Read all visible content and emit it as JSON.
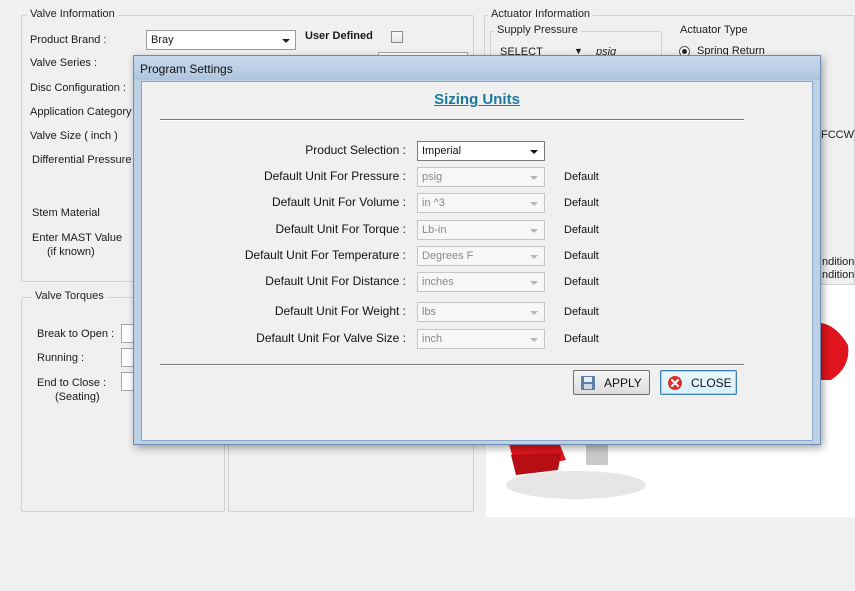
{
  "valve_info": {
    "legend": "Valve Information",
    "product_brand_label": "Product Brand :",
    "product_brand_value": "Bray",
    "user_defined_label": "User Defined",
    "valve_series_label": "Valve Series  :",
    "disc_config_label": "Disc Configuration :",
    "application_category_label": "Application Category",
    "valve_size_label": "Valve Size ( inch )",
    "differential_pressure_label": "Differential Pressure",
    "stem_material_label": "Stem Material",
    "enter_mast_label": "Enter MAST Value",
    "if_known_label": "(if known)"
  },
  "valve_torques": {
    "legend": "Valve Torques",
    "break_to_open_label": "Break to Open :",
    "running_label": "Running :",
    "end_to_close_label": "End to Close :",
    "seating_label": "(Seating)"
  },
  "actuator_info": {
    "legend": "Actuator Information",
    "supply_pressure_label": "Supply Pressure",
    "supply_pressure_value": "SELECT",
    "supply_pressure_unit": "psig",
    "actuator_type_label": "Actuator Type",
    "spring_return_label": "Spring Return",
    "fccw_fragment": "FCCW)",
    "condition_fragment_1": "ndition",
    "condition_fragment_2": "ndition"
  },
  "dialog": {
    "title": "Program Settings",
    "heading": "Sizing Units",
    "rows": [
      {
        "label": "Product Selection :",
        "value": "Imperial",
        "default": ""
      },
      {
        "label": "Default Unit For Pressure :",
        "value": "psig",
        "default": "Default"
      },
      {
        "label": "Default Unit For Volume :",
        "value": "in ^3",
        "default": "Default"
      },
      {
        "label": "Default Unit For Torque :",
        "value": "Lb-in",
        "default": "Default"
      },
      {
        "label": "Default Unit For Temperature :",
        "value": "Degrees F",
        "default": "Default"
      },
      {
        "label": "Default Unit For Distance :",
        "value": "inches",
        "default": "Default"
      },
      {
        "label": "Default Unit For Weight :",
        "value": "lbs",
        "default": "Default"
      },
      {
        "label": "Default Unit For Valve Size :",
        "value": "inch",
        "default": "Default"
      }
    ],
    "apply_label": "APPLY",
    "close_label": "CLOSE"
  },
  "colors": {
    "heading": "#1a7a9c",
    "actuator_red": "#e0141c",
    "dialog_frame": "#bcd0e6",
    "close_icon": "#d9342b"
  }
}
